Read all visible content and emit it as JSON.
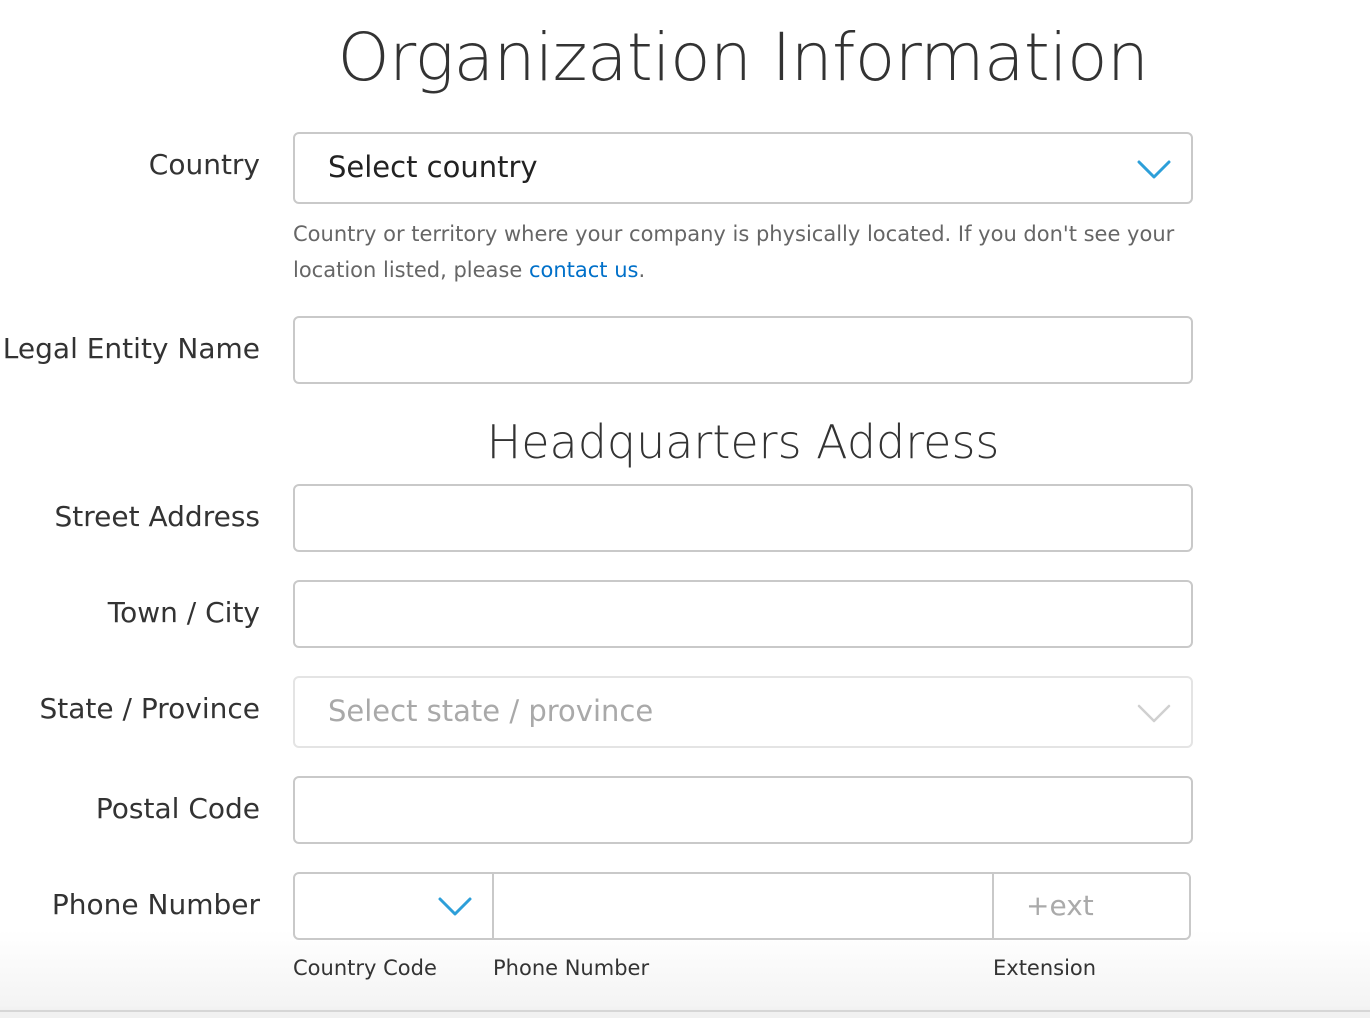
{
  "page": {
    "title": "Organization Information"
  },
  "country": {
    "label": "Country",
    "selected": "Select country",
    "help_text": "Country or territory where your company is physically located. If you don't see your location listed, please ",
    "help_link": "contact us",
    "help_suffix": "."
  },
  "legal_entity": {
    "label": "Legal Entity Name",
    "value": ""
  },
  "headquarters": {
    "title": "Headquarters Address",
    "street": {
      "label": "Street Address",
      "value": ""
    },
    "city": {
      "label": "Town / City",
      "value": ""
    },
    "state": {
      "label": "State / Province",
      "placeholder": "Select state / province"
    },
    "postal": {
      "label": "Postal Code",
      "value": ""
    },
    "phone": {
      "label": "Phone Number",
      "ext_placeholder": "+ext",
      "country_code_label": "Country Code",
      "number_label": "Phone Number",
      "extension_label": "Extension"
    }
  },
  "colors": {
    "accent": "#2d9fd9",
    "link": "#0070c9",
    "border": "#c9c9c9",
    "disabled_border": "#e4e4e4"
  },
  "icons": {
    "dropdown": "chevron-down-icon"
  }
}
